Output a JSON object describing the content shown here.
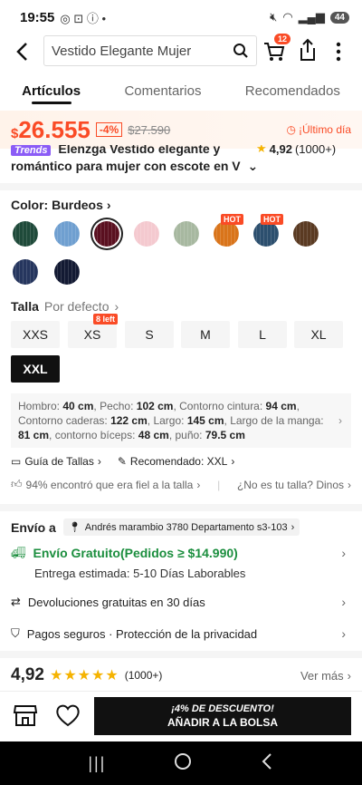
{
  "status": {
    "time": "19:55",
    "battery": "44"
  },
  "header": {
    "search_value": "Vestido Elegante Mujer",
    "cart_count": "12"
  },
  "tabs": [
    {
      "label": "Artículos"
    },
    {
      "label": "Comentarios"
    },
    {
      "label": "Recomendados"
    }
  ],
  "price": {
    "currency": "$",
    "amount": "26.555",
    "discount": "-4%",
    "original": "$27.590",
    "urgency": "¡Último día"
  },
  "title": {
    "badge": "Trends",
    "line1": "Elenzga Vestido elegante y",
    "line2": "romántico para mujer con escote en V",
    "rating": "4,92",
    "rating_count": "(1000+)"
  },
  "color": {
    "label": "Color: Burdeos",
    "hot_label": "HOT"
  },
  "size": {
    "label": "Talla",
    "default": "Por defecto",
    "stock_note": "8 left",
    "options": [
      "XXS",
      "XS",
      "S",
      "M",
      "L",
      "XL",
      "XXL"
    ],
    "selected": "XXL"
  },
  "measurements": {
    "k1": "Hombro:",
    "v1": "40 cm",
    "k2": "Pecho:",
    "v2": "102 cm",
    "k3": "Contorno cintura:",
    "v3": "94 cm",
    "k4": "Contorno caderas:",
    "v4": "122 cm",
    "k5": "Largo:",
    "v5": "145 cm",
    "k6": "Largo de la manga:",
    "v6": "81 cm",
    "k7": "contorno bíceps:",
    "v7": "48 cm",
    "k8": "puño:",
    "v8": "79.5 cm"
  },
  "guides": {
    "size_guide": "Guía de Tallas",
    "recommended": "Recomendado: XXL",
    "fit": "94% encontró que era fiel a la talla",
    "not_size": "¿No es tu talla? Dinos"
  },
  "shipping": {
    "label": "Envío a",
    "address": "Andrés marambio 3780 Departamento s3-103",
    "free": "Envío Gratuito(Pedidos ≥ $14.990)",
    "estimate": "Entrega estimada: 5-10 Días Laborables",
    "returns": "Devoluciones gratuitas en 30 días",
    "secure": "Pagos seguros · Protección de la privacidad"
  },
  "reviews": {
    "score": "4,92",
    "count": "(1000+)",
    "more": "Ver más"
  },
  "cta": {
    "promo": "¡4% DE DESCUENTO!",
    "label": "AÑADIR A LA BOLSA"
  },
  "colors": {
    "swatches": [
      "#1f4a3a",
      "#6f9fd0",
      "#5a1020",
      "#f4c9cf",
      "#a7b8a0",
      "#d9741a",
      "#2c4f6e",
      "#5a3a22",
      "#26365e",
      "#131a33"
    ],
    "accent": "#fa4b26",
    "free_shipping": "#1b8e3e"
  }
}
